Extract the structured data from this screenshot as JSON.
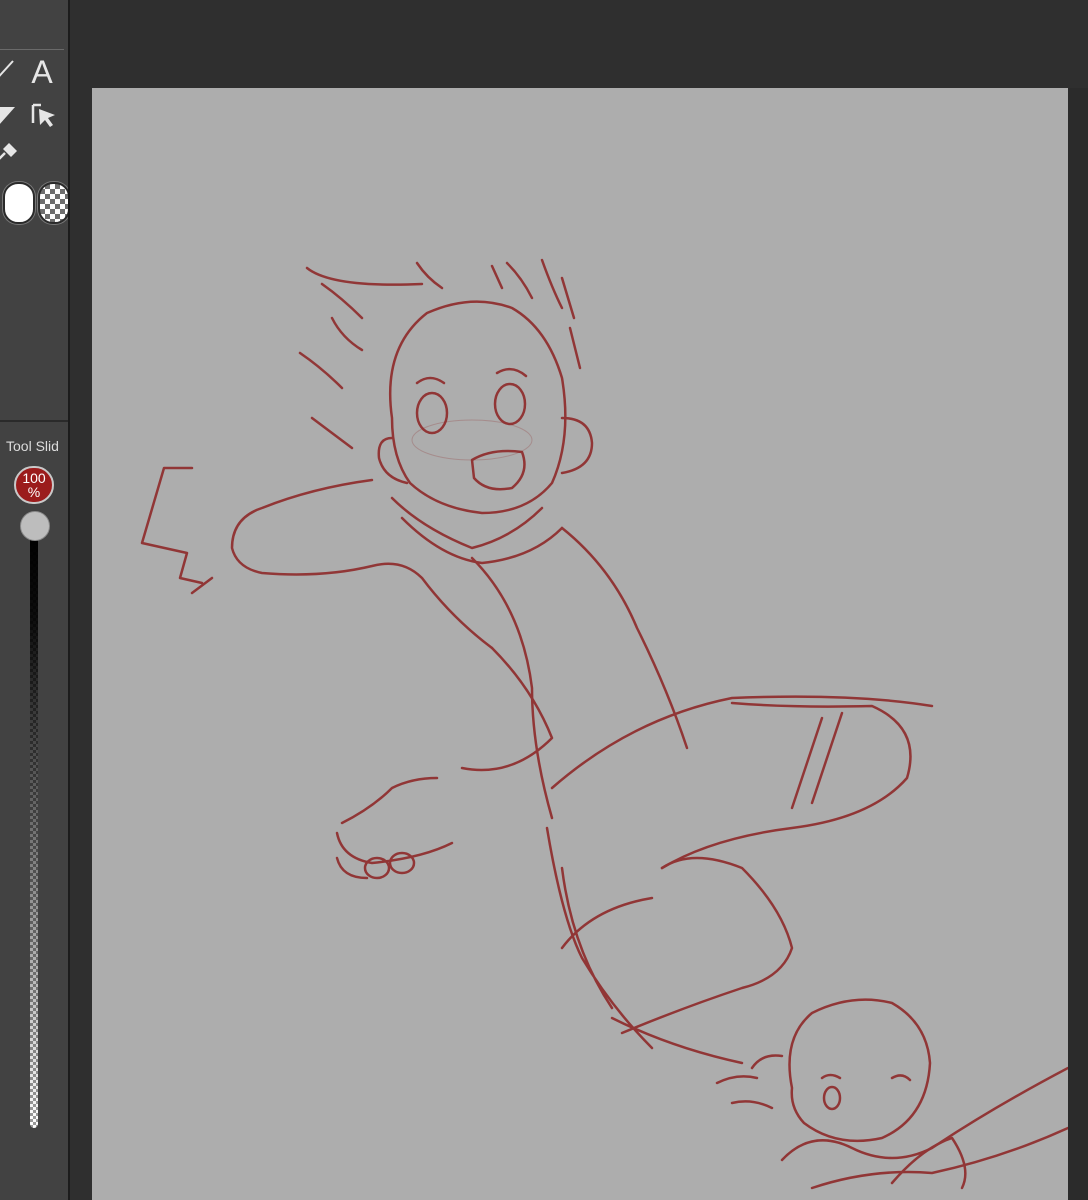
{
  "toolbar": {
    "tools": [
      {
        "id": "line",
        "icon": "line-tool-icon"
      },
      {
        "id": "text",
        "icon": "text-tool-icon",
        "glyph": "A"
      },
      {
        "id": "fill",
        "icon": "fill-tool-icon"
      },
      {
        "id": "select",
        "icon": "select-arrow-icon"
      },
      {
        "id": "eyedropper",
        "icon": "eyedropper-icon"
      }
    ]
  },
  "brush": {
    "shape_icon": "brush-shape-icon",
    "transparent_icon": "transparent-color-icon"
  },
  "tool_slider": {
    "label": "Tool Slid",
    "value": "100",
    "unit": "%",
    "level_percent": 100
  },
  "colors": {
    "panel": "#424242",
    "canvas": "#adadad",
    "sketch_stroke": "#8e2a2a",
    "badge": "#9b1c1c"
  }
}
